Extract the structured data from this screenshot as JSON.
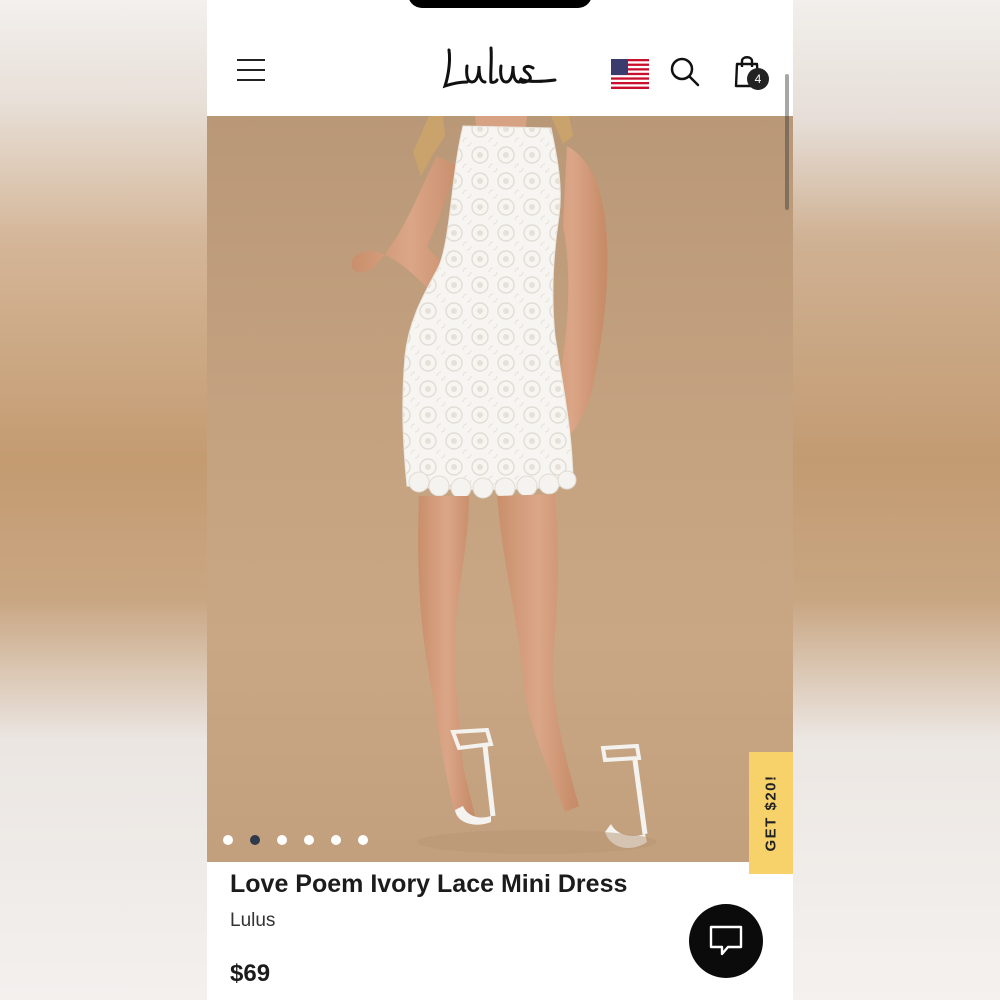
{
  "header": {
    "logo_text": "Lulus",
    "menu_icon": "hamburger-menu-icon",
    "region_icon": "us-flag-icon",
    "search_icon": "search-icon",
    "cart_icon": "shopping-bag-icon",
    "cart_count": "4"
  },
  "gallery": {
    "image_description_icon": "product-photo",
    "slide_count": 6,
    "active_slide": 2
  },
  "promo": {
    "label": "GET $20!",
    "color": "#f7d26b"
  },
  "product": {
    "title": "Love Poem Ivory Lace Mini Dress",
    "brand": "Lulus",
    "price": "$69"
  },
  "chat": {
    "icon": "chat-bubble-icon"
  }
}
